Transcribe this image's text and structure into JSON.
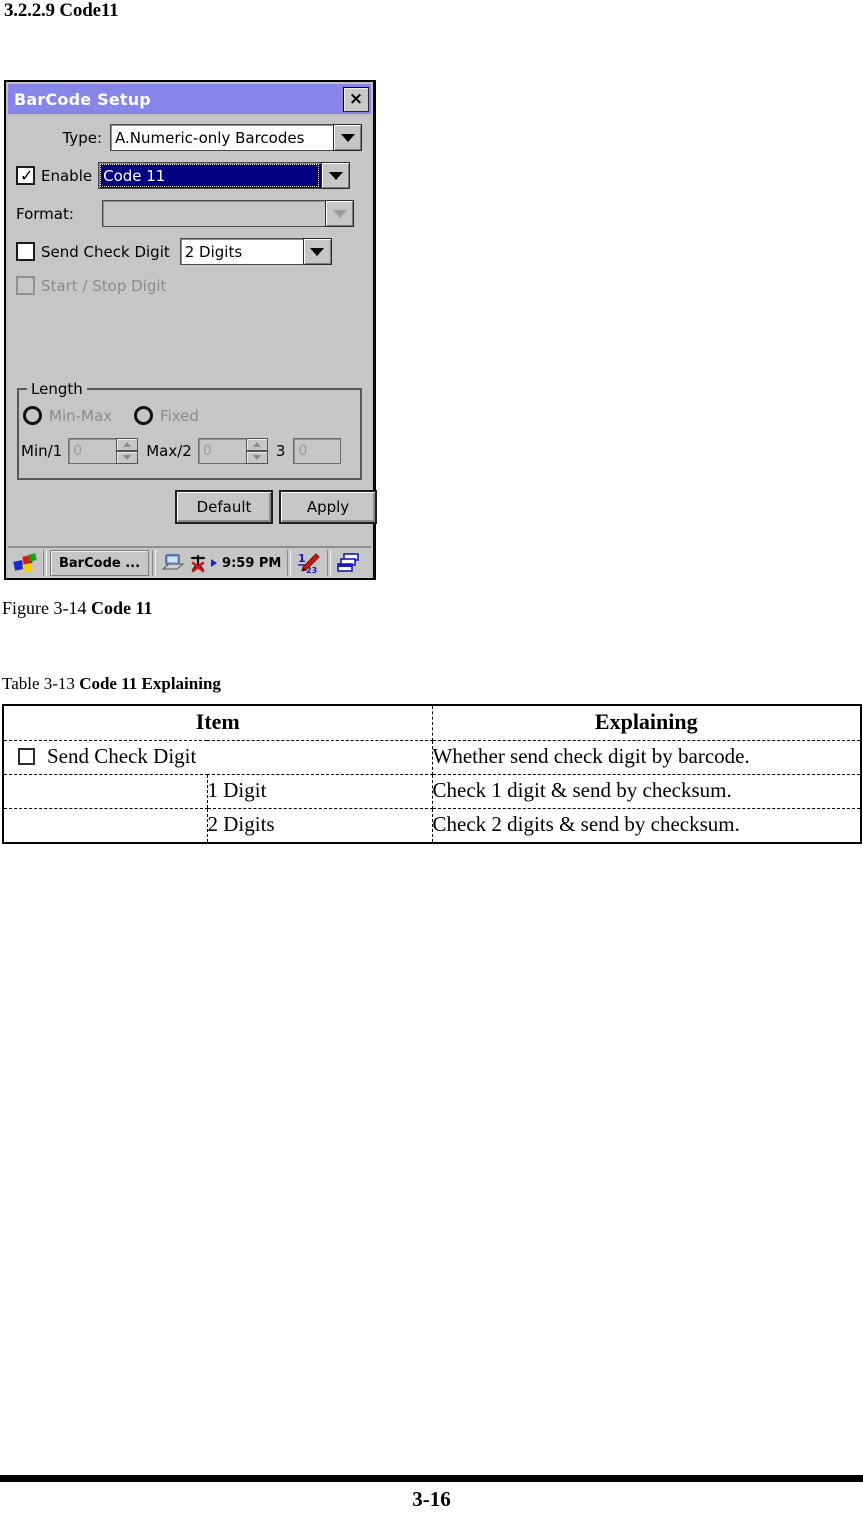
{
  "document": {
    "heading": "3.2.2.9 Code11",
    "figure_caption_prefix": "Figure 3-14 ",
    "figure_caption_bold": "Code 11",
    "table_caption_prefix": "Table 3-13 ",
    "table_caption_bold": "Code 11 Explaining",
    "page_number": "3-16"
  },
  "dialog": {
    "title": "BarCode Setup",
    "close_label": "×",
    "fields": {
      "type_label": "Type:",
      "type_value": "A.Numeric-only Barcodes",
      "enable_label": "Enable",
      "enable_checked": true,
      "enable_value": "Code 11",
      "format_label": "Format:",
      "format_value": "",
      "send_check_digit_label": "Send Check Digit",
      "send_check_digit_checked": false,
      "send_check_digit_value": "2 Digits",
      "start_stop_label": "Start / Stop Digit",
      "start_stop_checked": false
    },
    "length_group": {
      "title": "Length",
      "radio_minmax_label": "Min-Max",
      "radio_fixed_label": "Fixed",
      "min_label": "Min/1",
      "min_value": "0",
      "max_label": "Max/2",
      "max_value": "0",
      "third_label": "3",
      "third_value": "0"
    },
    "buttons": {
      "default_label": "Default",
      "apply_label": "Apply"
    },
    "taskbar": {
      "start_icon": "windows-start-icon",
      "task_label": "BarCode ...",
      "tray_desktop_icon": "desktop-icon",
      "tray_network_icon": "network-disconnected-icon",
      "time": "9:59 PM",
      "input_panel_icon": "input-panel-icon",
      "window_switch_icon": "window-switch-icon"
    },
    "colors": {
      "titlebar": "#8586e8",
      "face": "#c6c6c6",
      "selection": "#000080"
    }
  },
  "table": {
    "headers": [
      "Item",
      "Explaining"
    ],
    "rows": [
      {
        "item": "Send Check Digit",
        "has_checkbox": true,
        "explaining": "Whether send check digit by barcode.",
        "bold": false
      },
      {
        "item": "1 Digit",
        "has_checkbox": false,
        "explaining": "Check 1 digit & send by checksum.",
        "bold": false
      },
      {
        "item": "2 Digits",
        "has_checkbox": false,
        "explaining": "Check 2 digits & send by checksum.",
        "bold": true
      }
    ]
  }
}
